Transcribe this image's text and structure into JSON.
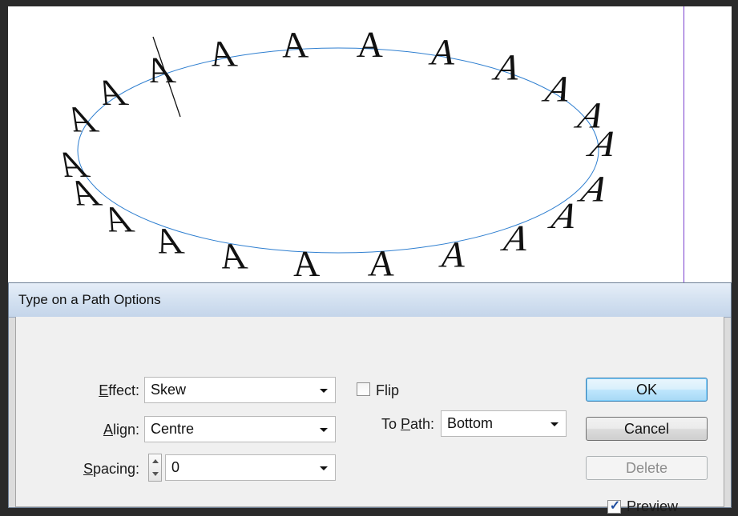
{
  "canvas": {
    "path_glyph": "A",
    "path_color": "#2f7fd0",
    "guide_color": "#7a3fd0"
  },
  "dialog": {
    "title": "Type on a Path Options",
    "effect": {
      "mnemonic": "E",
      "label_rest": "ffect:",
      "value": "Skew"
    },
    "align": {
      "mnemonic": "A",
      "label_rest": "lign:",
      "value": "Centre"
    },
    "spacing": {
      "mnemonic": "S",
      "label_rest": "pacing:",
      "value": "0"
    },
    "flip": {
      "label": "Flip",
      "checked": false
    },
    "to_path": {
      "label_before": "To ",
      "mnemonic": "P",
      "label_rest": "ath:",
      "value": "Bottom"
    },
    "buttons": {
      "ok": "OK",
      "cancel": "Cancel",
      "delete": "Delete"
    },
    "preview": {
      "label": "Preview",
      "checked": true
    }
  }
}
